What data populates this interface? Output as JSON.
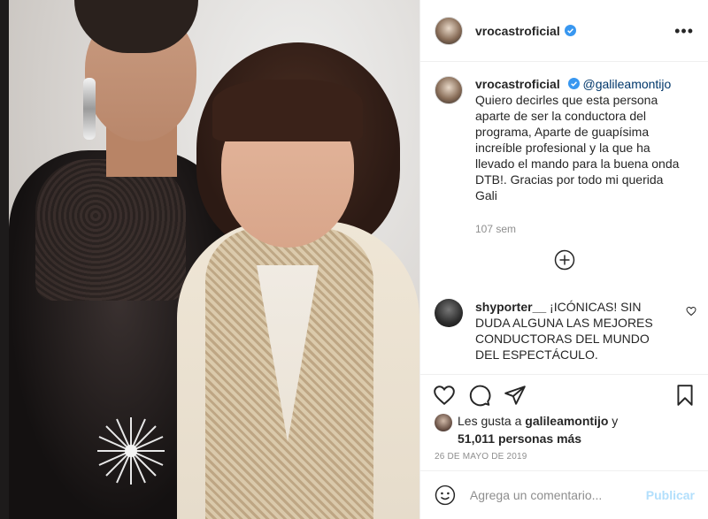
{
  "post": {
    "username": "vrocastroficial",
    "more_icon": "more-horizontal-icon",
    "verified_color": "#3897f0"
  },
  "caption": {
    "username": "vrocastroficial",
    "mention": "@galileamontijo",
    "text": "Quiero decirles que esta persona aparte de ser la conductora del programa, Aparte de guapísima increíble profesional y la que ha llevado el mando para la buena onda DTB!. Gracias por todo mi querida Gali",
    "time_ago": "107 sem"
  },
  "comment": {
    "username": "shyporter__",
    "text": "¡ICÓNICAS! SIN DUDA ALGUNA LAS MEJORES CONDUCTORAS DEL MUNDO DEL ESPECTÁCULO."
  },
  "likes": {
    "prefix": "Les gusta a ",
    "user": "galileamontijo",
    "connector": " y",
    "count": "51,011 personas más"
  },
  "date": "26 DE MAYO DE 2019",
  "add_comment": {
    "placeholder": "Agrega un comentario...",
    "publish_label": "Publicar",
    "publish_color": "#b2dffc"
  },
  "icons": {
    "like": "heart-icon",
    "comment": "comment-icon",
    "share": "share-icon",
    "save": "bookmark-icon",
    "emoji": "emoji-icon",
    "load_more": "plus-circle-icon"
  }
}
